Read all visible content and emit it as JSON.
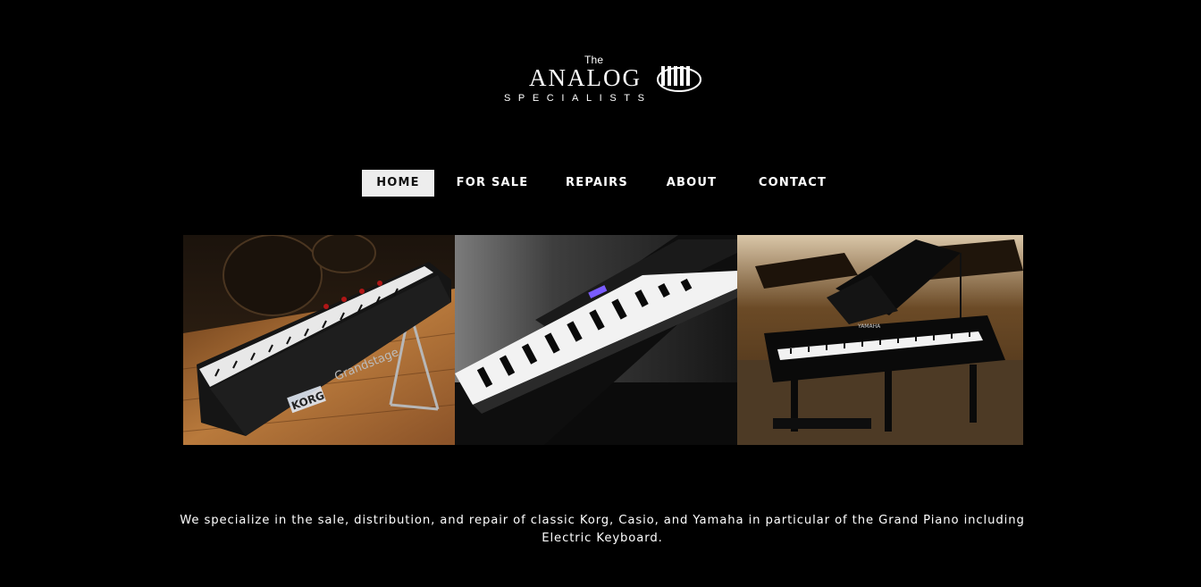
{
  "logo": {
    "the": "The",
    "analog": "ANALOG",
    "specialists": "SPECIALISTS"
  },
  "nav": {
    "items": [
      {
        "label": "HOME",
        "active": true
      },
      {
        "label": "FOR SALE",
        "active": false
      },
      {
        "label": "REPAIRS",
        "active": false
      },
      {
        "label": "ABOUT",
        "active": false
      },
      {
        "label": "CONTACT",
        "active": false
      }
    ]
  },
  "gallery": {
    "images": [
      {
        "label_brand": "KORG",
        "label_model": "Grandstage"
      },
      {},
      {
        "label_brand": "YAMAHA"
      }
    ]
  },
  "description": {
    "text": "We specialize in the sale, distribution, and repair of classic Korg, Casio, and Yamaha in particular of the Grand Piano including Electric Keyboard."
  },
  "colors": {
    "background": "#000000",
    "text": "#ffffff",
    "nav_active_bg": "#ededed",
    "nav_active_text": "#111111"
  }
}
